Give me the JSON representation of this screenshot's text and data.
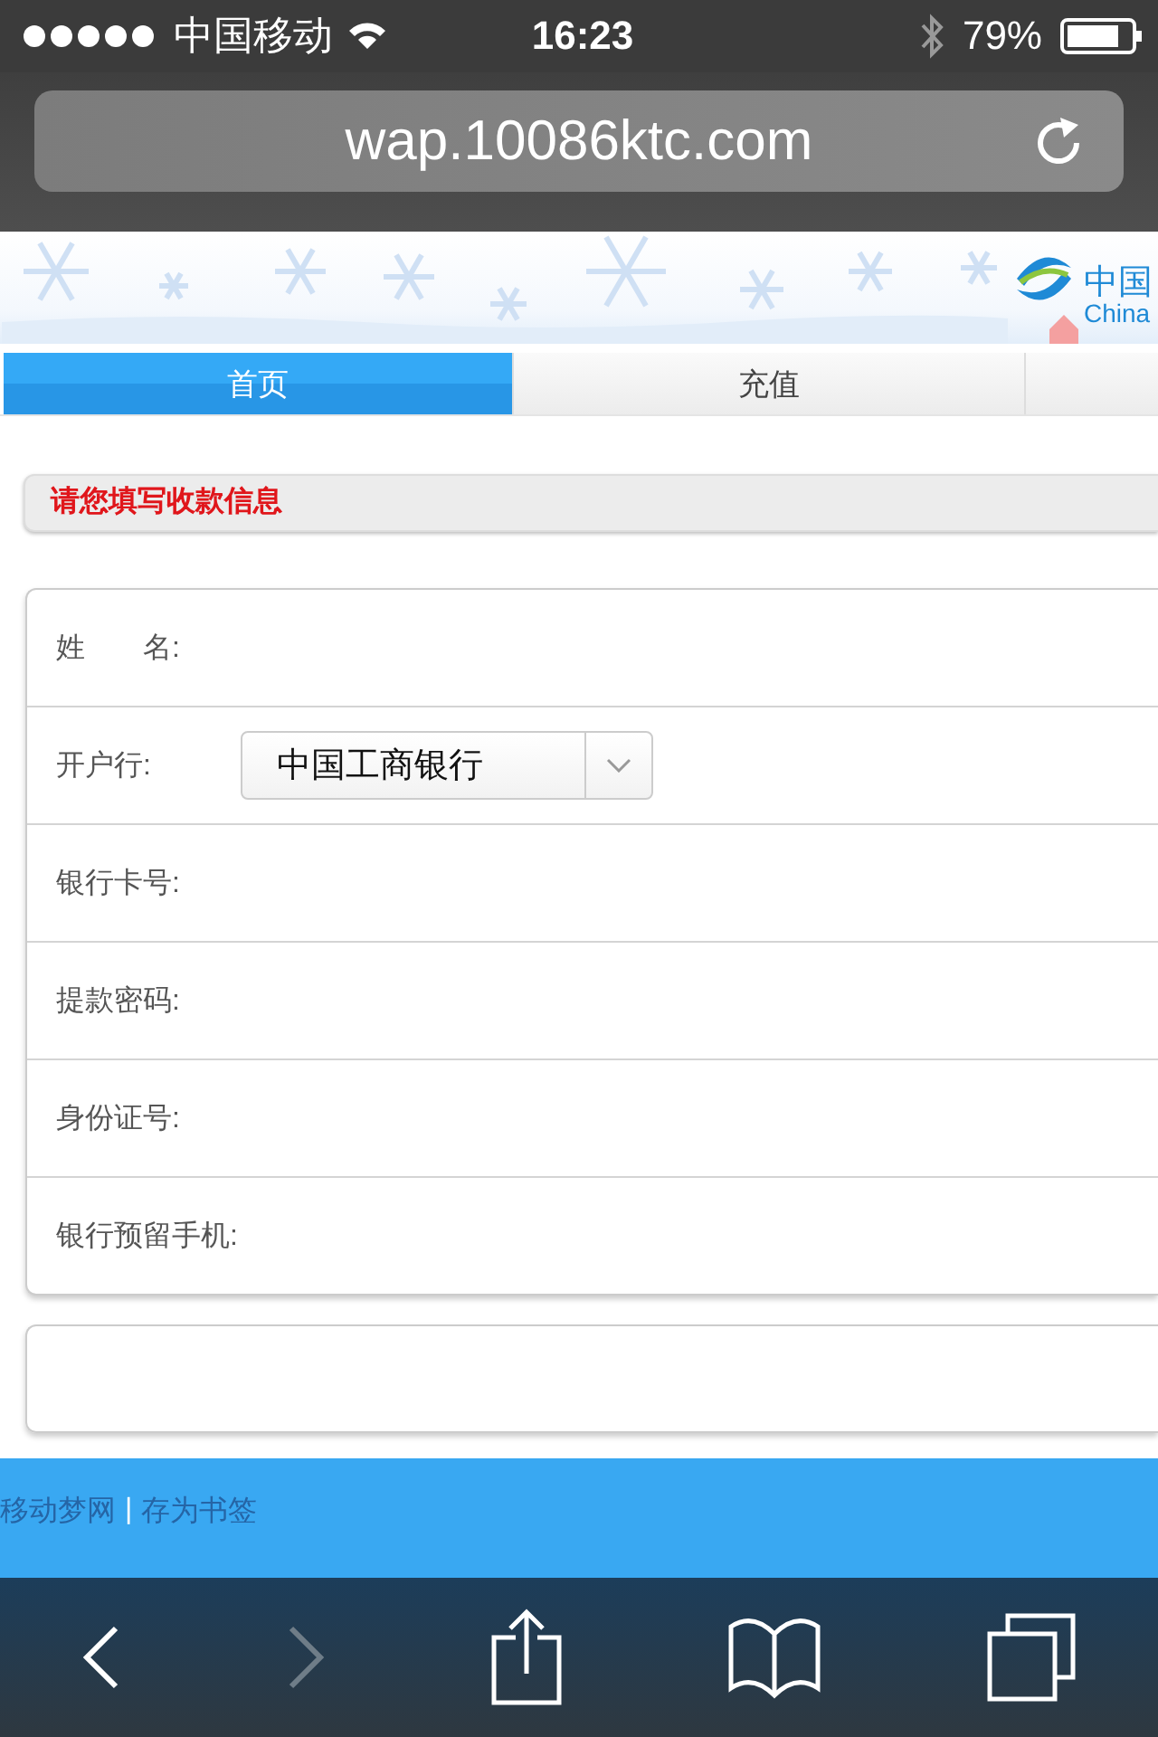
{
  "status_bar": {
    "carrier": "中国移动",
    "time": "16:23",
    "battery": "79%"
  },
  "address_bar": {
    "url": "wap.10086ktc.com"
  },
  "banner": {
    "logo_text": "中国",
    "logo_subtext": "China"
  },
  "tabs": [
    {
      "label": "首页",
      "selected": true
    },
    {
      "label": "充值",
      "selected": false
    }
  ],
  "section_title": "请您填写收款信息",
  "form": {
    "fields": [
      {
        "kind": "text",
        "label": "姓　　名:"
      },
      {
        "kind": "select",
        "label": "开户行:",
        "value": "中国工商银行"
      },
      {
        "kind": "text",
        "label": "银行卡号:"
      },
      {
        "kind": "text",
        "label": "提款密码:"
      },
      {
        "kind": "text",
        "label": "身份证号:"
      },
      {
        "kind": "text",
        "label": "银行预留手机:"
      }
    ]
  },
  "footer": {
    "lines": [
      [
        {
          "kind": "link",
          "text": "移动梦网"
        },
        {
          "kind": "plain",
          "text": "|"
        },
        {
          "kind": "link",
          "text": "存为书签"
        }
      ]
    ]
  },
  "toolbar": [
    {
      "kind": "back",
      "disabled": false
    },
    {
      "kind": "forward",
      "disabled": true
    },
    {
      "kind": "share",
      "disabled": false
    },
    {
      "kind": "bookmarks",
      "disabled": false
    },
    {
      "kind": "tabs",
      "disabled": false
    }
  ]
}
